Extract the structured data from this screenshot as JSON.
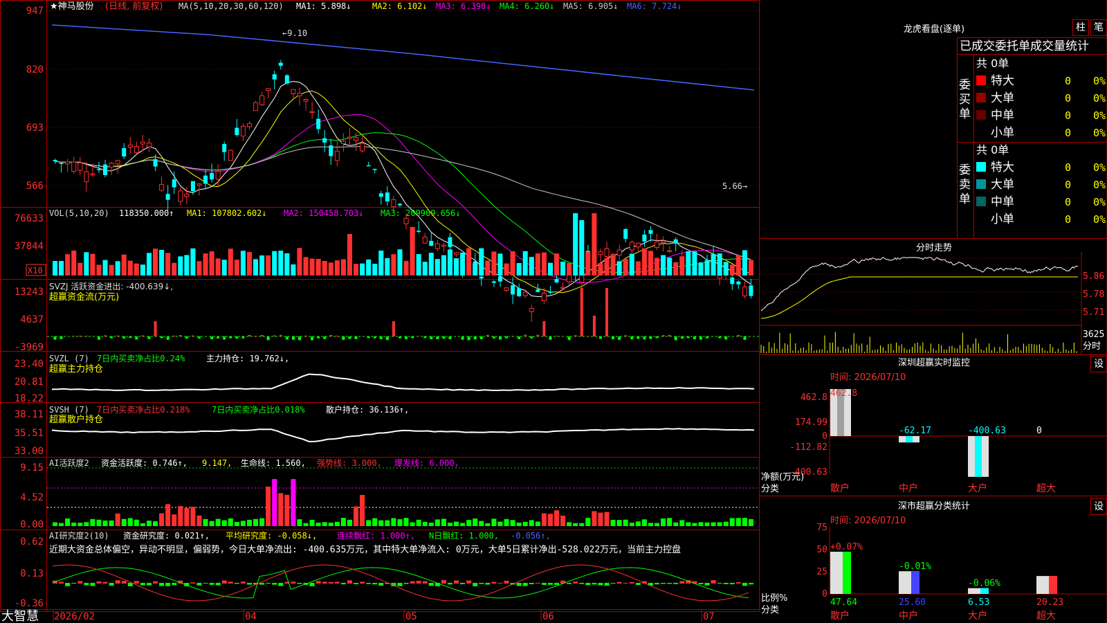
{
  "stock": {
    "name": "神马股份",
    "period": "(日线, 前复权)"
  },
  "ma_header": {
    "params": "MA(5,10,20,30,60,120)",
    "items": [
      {
        "label": "MA1:",
        "value": "5.898↓",
        "color": "#ffffff"
      },
      {
        "label": "MA2:",
        "value": "6.102↓",
        "color": "#ffff00"
      },
      {
        "label": "MA3:",
        "value": "6.398↓",
        "color": "#ff00ff"
      },
      {
        "label": "MA4:",
        "value": "6.260↓",
        "color": "#00ff00"
      },
      {
        "label": "MA5:",
        "value": "6.905↓",
        "color": "#c8c8c8"
      },
      {
        "label": "MA6:",
        "value": "7.724↓",
        "color": "#4466ff"
      }
    ]
  },
  "price_axis": [
    "947",
    "820",
    "693",
    "566"
  ],
  "price_marks": {
    "high": "9.10",
    "low": "5.66"
  },
  "vol_header": {
    "params": "VOL(5,10,20)",
    "value": "118350.000↑",
    "ma1": "MA1: 107802.602↓",
    "ma2": "MA2: 150458.703↓",
    "ma3": "MA3: 209909.656↓"
  },
  "vol_axis": [
    "76633",
    "37844"
  ],
  "vol_unit": "X10",
  "svzj": {
    "header": "SVZJ  活跃资金进出: -400.639↓,",
    "sub": "超赢资金流(万元)",
    "axis": [
      "13243",
      "4637",
      "-3969"
    ]
  },
  "svzl": {
    "header_a": "SVZL (7)",
    "header_b": "7日内买卖净占比0.24%",
    "header_c": "主力持仓: 19.762↓,",
    "sub": "超赢主力持仓",
    "axis": [
      "23.40",
      "20.81",
      "18.22"
    ]
  },
  "svsh": {
    "header_a": "SVSH (7)",
    "header_b": "7日内买卖净占比0.218%",
    "header_c": "7日内买卖净占比0.018%",
    "header_d": "散户持仓: 36.136↑,",
    "sub": "超赢散户持仓",
    "axis": [
      "38.11",
      "35.51",
      "33.00"
    ]
  },
  "ai_active": {
    "header_a": "AI活跃度2",
    "header_b": "资金活跃度: 0.746↑,",
    "header_c": "9.147,",
    "header_d": "生命线: 1.560,",
    "header_e": "强势线: 3.000,",
    "header_f": "爆发线: 6.000,",
    "axis": [
      "9.15",
      "4.52",
      "0.00"
    ]
  },
  "ai_research": {
    "header_a": "AI研究度2(10)",
    "header_b": "资金研究度: 0.021↑,",
    "header_c": "平均研究度: -0.058↓,",
    "header_d": "连续飘红: 1.000↑,",
    "header_e": "N日飘红: 1.000,",
    "header_f": "-0.056↑,",
    "comment": "近期大资金总体偏空，异动不明显，偏弱势，今日大单净流出: -400.635万元，其中特大单净流入: 0万元，大单5日累计净出-528.022万元，当前主力控盘",
    "axis": [
      "0.62",
      "0.13",
      "-0.36"
    ]
  },
  "date_axis": [
    "2026/02",
    "04",
    "05",
    "06",
    "07"
  ],
  "logo": "大智慧",
  "dragon": {
    "title": "龙虎看盘(逐单)",
    "btn1": "柱",
    "btn2": "笔",
    "heading": "已成交委托单成交量统计",
    "buy_label": "委买单",
    "sell_label": "委卖单",
    "buy_total": "共 0单",
    "sell_total": "共 0单",
    "buy_rows": [
      {
        "label": "特大",
        "count": "0",
        "pct": "0%",
        "color": "#ff0000"
      },
      {
        "label": "大单",
        "count": "0",
        "pct": "0%",
        "color": "#990000"
      },
      {
        "label": "中单",
        "count": "0",
        "pct": "0%",
        "color": "#660000"
      },
      {
        "label": "小单",
        "count": "0",
        "pct": "0%",
        "color": ""
      }
    ],
    "sell_rows": [
      {
        "label": "特大",
        "count": "0",
        "pct": "0%",
        "color": "#00ffff"
      },
      {
        "label": "大单",
        "count": "0",
        "pct": "0%",
        "color": "#009999"
      },
      {
        "label": "中单",
        "count": "0",
        "pct": "0%",
        "color": "#006666"
      },
      {
        "label": "小单",
        "count": "0",
        "pct": "0%",
        "color": ""
      }
    ]
  },
  "intraday": {
    "title": "分时走势",
    "axis": [
      "5.86",
      "5.78",
      "5.71"
    ],
    "vol_top": "3625",
    "vol_label": "分时"
  },
  "sz_monitor": {
    "title": "深圳超赢实时监控",
    "settings": "设",
    "time": "时间: 2026/07/10",
    "axis": [
      "462.8",
      "174.99",
      "0",
      "-112.82",
      "-400.63"
    ],
    "ylabel": "净额(万元)",
    "xlabel": "分类",
    "categories": [
      "散户",
      "中户",
      "大户",
      "超大"
    ],
    "values": [
      "462.8",
      "-62.17",
      "-400.63",
      "0"
    ]
  },
  "sz_class": {
    "title": "深市超赢分类统计",
    "settings": "设",
    "time": "时间: 2026/07/10",
    "axis": [
      "75",
      "50",
      "25",
      "0"
    ],
    "ylabel": "比例%",
    "xlabel": "分类",
    "categories": [
      "散户",
      "中户",
      "大户",
      "超大"
    ],
    "changes": [
      "+0.07%",
      "-0.01%",
      "-0.06%",
      ""
    ],
    "values": [
      "47.64",
      "25.60",
      "6.53",
      "20.23"
    ]
  }
}
